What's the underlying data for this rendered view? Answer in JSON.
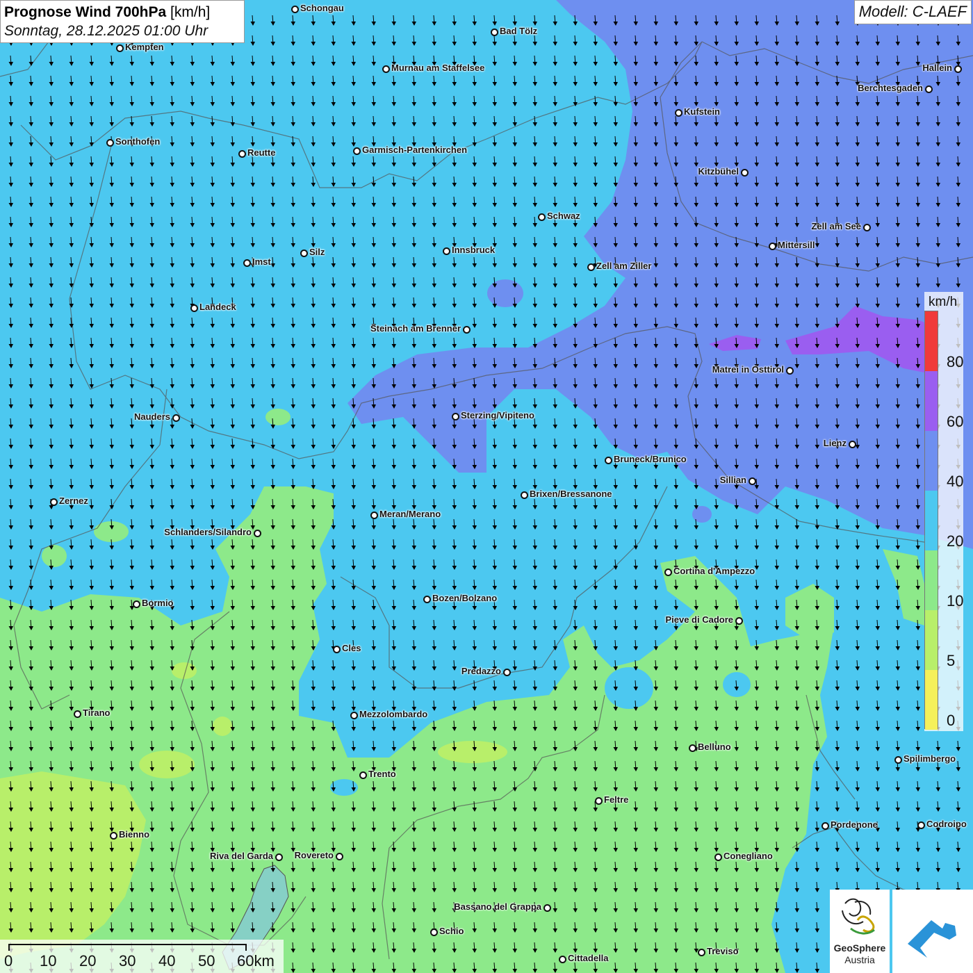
{
  "header": {
    "title_bold": "Prognose Wind 700hPa",
    "title_unit": "[km/h]",
    "subtitle": "Sonntag, 28.12.2025 01:00 Uhr",
    "model": "Modell: C-LAEF"
  },
  "colors": {
    "speed_0_5": "#f5f05a",
    "speed_5_10": "#b8ef6a",
    "speed_10_20": "#8de98a",
    "speed_20_40": "#4cc8f0",
    "speed_40_60": "#6e8ff0",
    "speed_60_80": "#9a5ef0",
    "speed_80_plus": "#f03a3a",
    "arrow": "#000000"
  },
  "legend": {
    "unit": "km/h",
    "ticks": [
      "80",
      "60",
      "40",
      "20",
      "10",
      "5",
      "0"
    ]
  },
  "scale_bar": {
    "labels": [
      "0",
      "10",
      "20",
      "30",
      "40",
      "50",
      "60km"
    ]
  },
  "wind_field": {
    "arrow_icon": "wind-arrow-icon",
    "direction": "from north (arrows pointing south)"
  },
  "cities": [
    {
      "name": "Schongau"
    },
    {
      "name": "Bad Tölz"
    },
    {
      "name": "Kempten"
    },
    {
      "name": "Murnau am Staffelsee"
    },
    {
      "name": "Hallein"
    },
    {
      "name": "Berchtesgaden"
    },
    {
      "name": "Kufstein"
    },
    {
      "name": "Sonthofen"
    },
    {
      "name": "Reutte"
    },
    {
      "name": "Garmisch-Partenkirchen"
    },
    {
      "name": "Kitzbühel"
    },
    {
      "name": "Schwaz"
    },
    {
      "name": "Zell am See"
    },
    {
      "name": "Mittersill"
    },
    {
      "name": "Silz"
    },
    {
      "name": "Innsbruck"
    },
    {
      "name": "Imst"
    },
    {
      "name": "Zell am Ziller"
    },
    {
      "name": "Landeck"
    },
    {
      "name": "Steinach am Brenner"
    },
    {
      "name": "Matrei in Osttirol"
    },
    {
      "name": "Nauders"
    },
    {
      "name": "Sterzing/Vipiteno"
    },
    {
      "name": "Lienz"
    },
    {
      "name": "Bruneck/Brunico"
    },
    {
      "name": "Sillian"
    },
    {
      "name": "Zernez"
    },
    {
      "name": "Brixen/Bressanone"
    },
    {
      "name": "Meran/Merano"
    },
    {
      "name": "Schlanders/Silandro"
    },
    {
      "name": "Cortina d'Ampezzo"
    },
    {
      "name": "Bozen/Bolzano"
    },
    {
      "name": "Bormio"
    },
    {
      "name": "Pieve di Cadore"
    },
    {
      "name": "Cles"
    },
    {
      "name": "Predazzo"
    },
    {
      "name": "Tirano"
    },
    {
      "name": "Mezzolombardo"
    },
    {
      "name": "Belluno"
    },
    {
      "name": "Spilimbergo"
    },
    {
      "name": "Trento"
    },
    {
      "name": "Feltre"
    },
    {
      "name": "Pordenone"
    },
    {
      "name": "Codroipo"
    },
    {
      "name": "Bienno"
    },
    {
      "name": "Riva del Garda"
    },
    {
      "name": "Rovereto"
    },
    {
      "name": "Conegliano"
    },
    {
      "name": "Bassano del Grappa"
    },
    {
      "name": "Schio"
    },
    {
      "name": "Treviso"
    },
    {
      "name": "Cittadella"
    }
  ],
  "logos": {
    "geosphere_line1": "GeoSphere",
    "geosphere_line2": "Austria"
  }
}
